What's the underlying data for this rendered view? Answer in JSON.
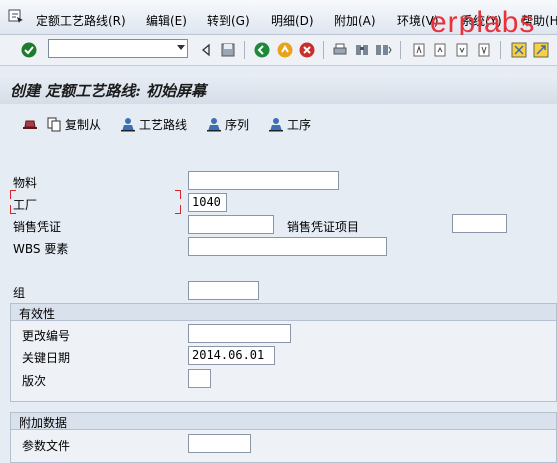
{
  "menu": {
    "items": [
      "定额工艺路线(R)",
      "编辑(E)",
      "转到(G)",
      "明细(D)",
      "附加(A)",
      "环境(V)",
      "系统(Y)",
      "帮助(H)"
    ]
  },
  "watermark": "erplabs",
  "title": "创建 定额工艺路线: 初始屏幕",
  "app_toolbar": {
    "copy_from": "复制从",
    "routing": "工艺路线",
    "sequence": "序列",
    "operation": "工序"
  },
  "fields": {
    "material": {
      "label": "物料",
      "value": ""
    },
    "plant": {
      "label": "工厂",
      "value": "1040"
    },
    "sales_doc": {
      "label": "销售凭证",
      "value": ""
    },
    "sales_doc_item": {
      "label": "销售凭证项目",
      "value": ""
    },
    "wbs": {
      "label": "WBS 要素",
      "value": ""
    },
    "group": {
      "label": "组",
      "value": ""
    }
  },
  "validity": {
    "header": "有效性",
    "change_number": {
      "label": "更改编号",
      "value": ""
    },
    "key_date": {
      "label": "关键日期",
      "value": "2014.06.01"
    },
    "revision": {
      "label": "版次",
      "value": ""
    }
  },
  "additional": {
    "header": "附加数据",
    "profile": {
      "label": "参数文件",
      "value": ""
    }
  },
  "colors": {
    "watermark": "#e8323a",
    "required_marker": "#d6242c"
  }
}
